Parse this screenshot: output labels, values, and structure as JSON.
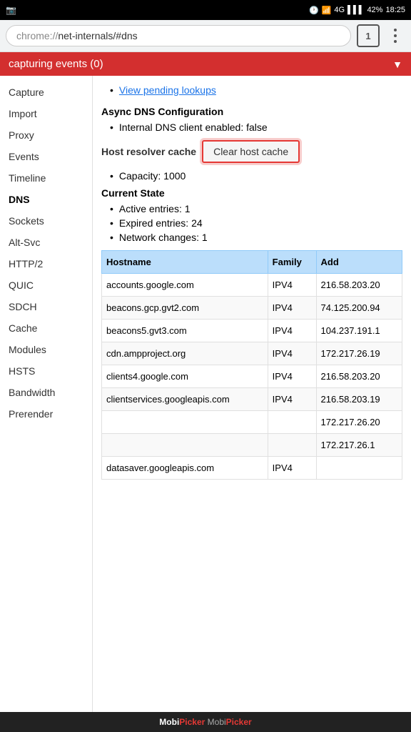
{
  "statusBar": {
    "leftIcon": "camera-icon",
    "time": "18:25",
    "battery": "42%",
    "signal": "4G"
  },
  "addressBar": {
    "scheme": "chrome://",
    "host": "net-internals/#dns",
    "tabCount": "1"
  },
  "capturingBar": {
    "label": "capturing events (0)",
    "arrow": "▼"
  },
  "sidebar": {
    "items": [
      {
        "id": "capture",
        "label": "Capture",
        "active": false
      },
      {
        "id": "import",
        "label": "Import",
        "active": false
      },
      {
        "id": "proxy",
        "label": "Proxy",
        "active": false
      },
      {
        "id": "events",
        "label": "Events",
        "active": false
      },
      {
        "id": "timeline",
        "label": "Timeline",
        "active": false
      },
      {
        "id": "dns",
        "label": "DNS",
        "active": true
      },
      {
        "id": "sockets",
        "label": "Sockets",
        "active": false
      },
      {
        "id": "alt-svc",
        "label": "Alt-Svc",
        "active": false
      },
      {
        "id": "http2",
        "label": "HTTP/2",
        "active": false
      },
      {
        "id": "quic",
        "label": "QUIC",
        "active": false
      },
      {
        "id": "sdch",
        "label": "SDCH",
        "active": false
      },
      {
        "id": "cache",
        "label": "Cache",
        "active": false
      },
      {
        "id": "modules",
        "label": "Modules",
        "active": false
      },
      {
        "id": "hsts",
        "label": "HSTS",
        "active": false
      },
      {
        "id": "bandwidth",
        "label": "Bandwidth",
        "active": false
      },
      {
        "id": "prerender",
        "label": "Prerender",
        "active": false
      }
    ]
  },
  "content": {
    "viewPendingLink": "View pending lookups",
    "asyncDnsTitle": "Async DNS Configuration",
    "asyncDnsItems": [
      "Internal DNS client enabled: false"
    ],
    "hostResolverLabel": "Host resolver cache",
    "clearCacheButton": "Clear host cache",
    "capacityItem": "Capacity: 1000",
    "currentStateTitle": "Current State",
    "currentStateItems": [
      "Active entries: 1",
      "Expired entries: 24",
      "Network changes: 1"
    ],
    "tableHeaders": [
      "Hostname",
      "Family",
      "Add"
    ],
    "tableRows": [
      {
        "hostname": "accounts.google.com",
        "family": "IPV4",
        "addr": "216.58.203.20"
      },
      {
        "hostname": "beacons.gcp.gvt2.com",
        "family": "IPV4",
        "addr": "74.125.200.94"
      },
      {
        "hostname": "beacons5.gvt3.com",
        "family": "IPV4",
        "addr": "104.237.191.1"
      },
      {
        "hostname": "cdn.ampproject.org",
        "family": "IPV4",
        "addr": "172.217.26.19"
      },
      {
        "hostname": "clients4.google.com",
        "family": "IPV4",
        "addr": "216.58.203.20"
      },
      {
        "hostname": "clientservices.googleapis.com",
        "family": "IPV4",
        "addr": "216.58.203.19"
      },
      {
        "hostname": "",
        "family": "",
        "addr": "172.217.26.20"
      },
      {
        "hostname": "",
        "family": "",
        "addr": "172.217.26.1"
      },
      {
        "hostname": "datasaver.googleapis.com",
        "family": "IPV4",
        "addr": ""
      }
    ]
  },
  "watermark": {
    "text1": "Mobi",
    "text2": "Picker"
  }
}
